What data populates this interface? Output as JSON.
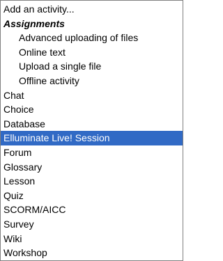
{
  "activity_select": {
    "placeholder": "Add an activity...",
    "group_label": "Assignments",
    "assignment_options": [
      "Advanced uploading of files",
      "Online text",
      "Upload a single file",
      "Offline activity"
    ],
    "options": [
      "Chat",
      "Choice",
      "Database",
      "Elluminate Live! Session",
      "Forum",
      "Glossary",
      "Lesson",
      "Quiz",
      "SCORM/AICC",
      "Survey",
      "Wiki",
      "Workshop"
    ],
    "selected": "Elluminate Live! Session",
    "highlight_color": "#316ac5"
  }
}
